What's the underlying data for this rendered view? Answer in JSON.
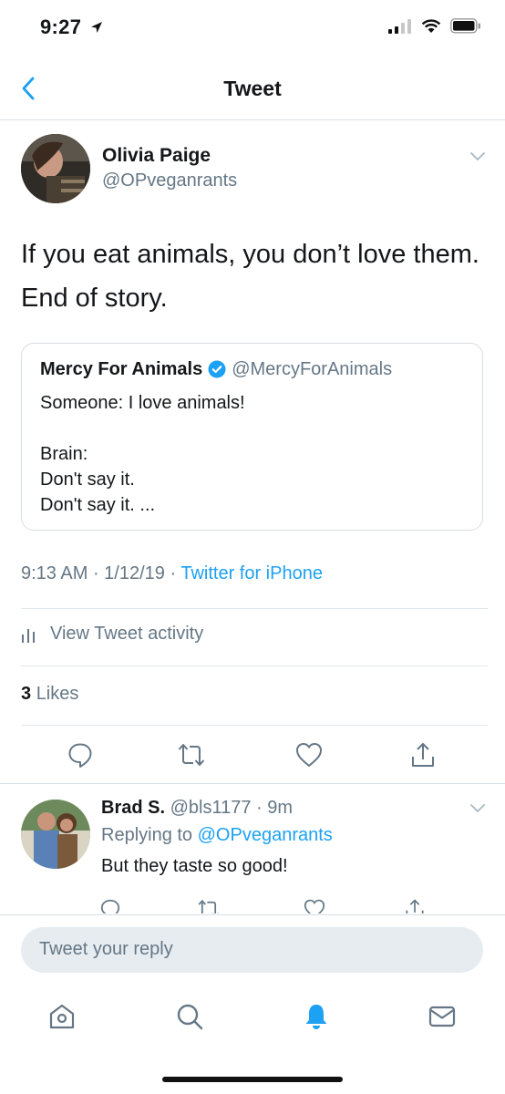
{
  "status_bar": {
    "time": "9:27"
  },
  "nav": {
    "title": "Tweet"
  },
  "tweet": {
    "author_name": "Olivia Paige",
    "author_handle": "@OPveganrants",
    "text": "If you eat animals, you don’t love them. End of story.",
    "quote": {
      "name": "Mercy For Animals",
      "handle": "@MercyForAnimals",
      "body": "Someone: I love animals!\n\nBrain:\nDon't say it.\nDon't say it. ..."
    },
    "time": "9:13 AM",
    "date": "1/12/19",
    "source": "Twitter for iPhone",
    "activity_label": "View Tweet activity",
    "likes_count": "3",
    "likes_label": "Likes"
  },
  "reply": {
    "name": "Brad S.",
    "handle": "@bls1177",
    "age": "9m",
    "replying_prefix": "Replying to",
    "replying_to": "@OPveganrants",
    "text": "But they taste so good!"
  },
  "composer": {
    "placeholder": "Tweet your reply"
  },
  "colors": {
    "accent": "#1da1f2",
    "secondary_text": "#657786",
    "border": "#d8dee2"
  }
}
